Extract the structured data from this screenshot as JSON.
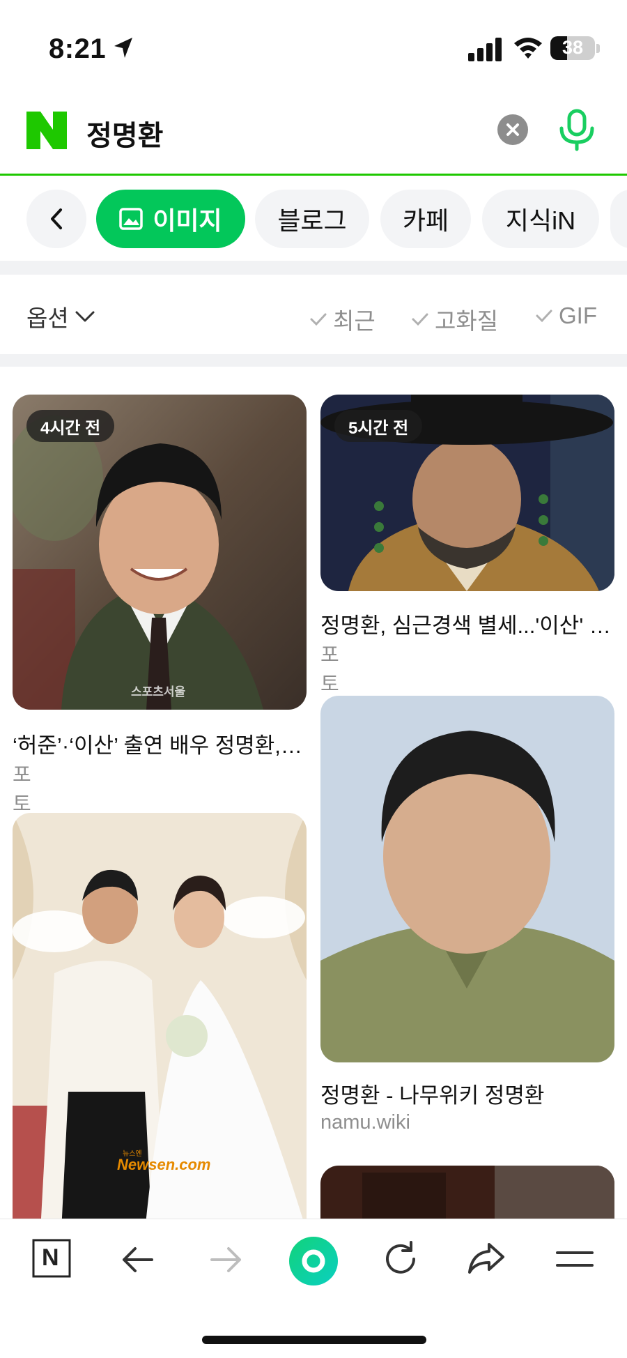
{
  "status_bar": {
    "time": "8:21",
    "battery": "38",
    "battery_level": 0.38
  },
  "search": {
    "query": "정명환",
    "logo_letter": "N"
  },
  "tabs": [
    {
      "label": "이미지",
      "active": true
    },
    {
      "label": "블로그",
      "active": false
    },
    {
      "label": "카페",
      "active": false
    },
    {
      "label": "지식iN",
      "active": false
    }
  ],
  "options": {
    "label": "옵션",
    "filters": [
      "최근",
      "고화질",
      "GIF"
    ]
  },
  "results": [
    {
      "badge": "4시간 전",
      "title": "‘허준’·‘이산’ 출연 배우 정명환, 아내 외모보다",
      "source": "포토뉴스",
      "watermark": "스포츠서울"
    },
    {
      "badge": "5시간 전",
      "title": "정명환, 심근경색 별세...'이산' 출연 원로배우",
      "source": "포토뉴스"
    },
    {
      "badge": "",
      "title": "정명환 - 나무위키 정명환",
      "source": "namu.wiki"
    },
    {
      "badge": "",
      "title": "",
      "source": "",
      "watermark": "Newsen.com",
      "watermark_small": "뉴스엔"
    }
  ],
  "bottom_nav": {
    "home_label": "N"
  },
  "colors": {
    "naver_green": "#03c75a",
    "logo_green": "#1ec800",
    "mic_green": "#19ce60"
  }
}
